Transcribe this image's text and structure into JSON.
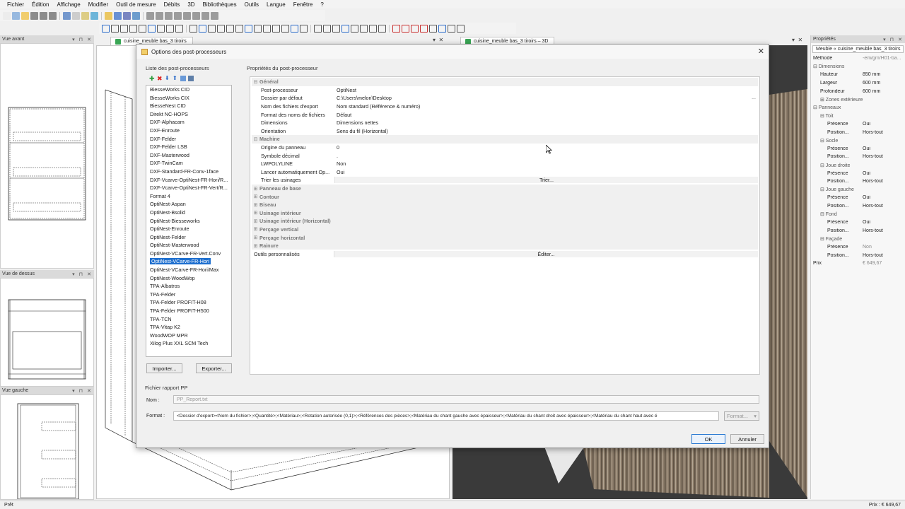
{
  "menu": [
    "Fichier",
    "Édition",
    "Affichage",
    "Modifier",
    "Outil de mesure",
    "Débits",
    "3D",
    "Bibliothèques",
    "Outils",
    "Langue",
    "Fenêtre",
    "?"
  ],
  "panes": {
    "front": "Vue avant",
    "top": "Vue de dessus",
    "left": "Vue gauche"
  },
  "tabs": {
    "doc2d": "cuisine_meuble bas_3 tiroirs",
    "doc3d": "cuisine_meuble bas_3 tiroirs – 3D"
  },
  "properties": {
    "title": "Propriétés",
    "object": "Meuble « cuisine_meuble bas_3 tiroirs",
    "rows": [
      {
        "k": "Méthode",
        "v": "-em/gm/H01-ba...",
        "indent": 0,
        "grp": false
      },
      {
        "k": "⊟ Dimensions",
        "v": "",
        "indent": 0,
        "grp": true
      },
      {
        "k": "Hauteur",
        "v": "850 mm",
        "indent": 10,
        "grp": false
      },
      {
        "k": "Largeur",
        "v": "600 mm",
        "indent": 10,
        "grp": false
      },
      {
        "k": "Profondeur",
        "v": "600 mm",
        "indent": 10,
        "grp": false
      },
      {
        "k": "⊞ Zones extérieures",
        "v": "",
        "indent": 10,
        "grp": true
      },
      {
        "k": "⊟ Panneaux",
        "v": "",
        "indent": 0,
        "grp": true
      },
      {
        "k": "⊟ Toit",
        "v": "",
        "indent": 10,
        "grp": true
      },
      {
        "k": "Présence",
        "v": "Oui",
        "indent": 20,
        "grp": false
      },
      {
        "k": "Position...",
        "v": "Hors-tout",
        "indent": 20,
        "grp": false
      },
      {
        "k": "⊟ Socle",
        "v": "",
        "indent": 10,
        "grp": true
      },
      {
        "k": "Présence",
        "v": "Oui",
        "indent": 20,
        "grp": false
      },
      {
        "k": "Position...",
        "v": "Hors-tout",
        "indent": 20,
        "grp": false
      },
      {
        "k": "⊟ Joue droite",
        "v": "",
        "indent": 10,
        "grp": true
      },
      {
        "k": "Présence",
        "v": "Oui",
        "indent": 20,
        "grp": false
      },
      {
        "k": "Position...",
        "v": "Hors-tout",
        "indent": 20,
        "grp": false
      },
      {
        "k": "⊟ Joue gauche",
        "v": "",
        "indent": 10,
        "grp": true
      },
      {
        "k": "Présence",
        "v": "Oui",
        "indent": 20,
        "grp": false
      },
      {
        "k": "Position...",
        "v": "Hors-tout",
        "indent": 20,
        "grp": false
      },
      {
        "k": "⊟ Fond",
        "v": "",
        "indent": 10,
        "grp": true
      },
      {
        "k": "Présence",
        "v": "Oui",
        "indent": 20,
        "grp": false
      },
      {
        "k": "Position...",
        "v": "Hors-tout",
        "indent": 20,
        "grp": false
      },
      {
        "k": "⊟ Façade",
        "v": "",
        "indent": 10,
        "grp": true
      },
      {
        "k": "Présence",
        "v": "Non",
        "indent": 20,
        "grp": false
      },
      {
        "k": "Position...",
        "v": "Hors-tout",
        "indent": 20,
        "grp": false
      },
      {
        "k": "Prix",
        "v": "€ 649,67",
        "indent": 0,
        "grp": false
      }
    ]
  },
  "dialog": {
    "title": "Options des post-processeurs",
    "list_label": "Liste des post-processeurs",
    "selected_index": 21,
    "items": [
      "BiesseWorks CID",
      "BiesseWorks CIX",
      "BiesseNest CID",
      "Direkt NC-HOPS",
      "DXF-Alphacam",
      "DXF-Enroute",
      "DXF-Felder",
      "DXF-Felder LSB",
      "DXF-Masterwood",
      "DXF-TwinCam",
      "DXF-Standard-FR-Conv-1face",
      "DXF-Vcarve-OptiNest-FR-Hori/R...",
      "DXF-Vcarve-OptiNest-FR-Vert/R...",
      "Format 4",
      "OptiNest-Aspan",
      "OptiNest-Bsolid",
      "OptiNest-Biesseworks",
      "OptiNest-Enroute",
      "OptiNest-Felder",
      "OptiNest-Masterwood",
      "OptiNest-VCarve-FR-Vert.Conv",
      "OptiNest-VCarve-FR-Hori",
      "OptiNest-VCarve-FR-Hori/Max",
      "OptiNest-WoodWop",
      "TPA-Albatros",
      "TPA-Felder",
      "TPA-Felder PROFIT-H08",
      "TPA-Felder PROFIT-H500",
      "TPA-TCN",
      "TPA-Vitap K2",
      "WoodWOP MPR",
      "Xilog Plus XXL SCM Tech"
    ],
    "import_label": "Importer...",
    "export_label": "Exporter...",
    "props_label": "Propriétés du post-processeur",
    "grid": [
      {
        "type": "cat",
        "name": "Général"
      },
      {
        "type": "row",
        "name": "Post-processeur",
        "value": "OptiNest"
      },
      {
        "type": "row",
        "name": "Dossier par défaut",
        "value": "C:\\Users\\melon\\Desktop",
        "dots": "..."
      },
      {
        "type": "row",
        "name": "Nom des fichiers d'export",
        "value": "Nom standard (Référence & numéro)"
      },
      {
        "type": "row",
        "name": "Format des noms de fichiers",
        "value": "Défaut"
      },
      {
        "type": "row",
        "name": "Dimensions",
        "value": "Dimensions nettes"
      },
      {
        "type": "row",
        "name": "Orientation",
        "value": "Sens du fil (Horizontal)"
      },
      {
        "type": "cat",
        "name": "Machine"
      },
      {
        "type": "row",
        "name": "Origine du panneau",
        "value": "0"
      },
      {
        "type": "row",
        "name": "Symbole décimal",
        "value": "."
      },
      {
        "type": "row",
        "name": "LWPOLYLINE",
        "value": "Non"
      },
      {
        "type": "row",
        "name": "Lancer automatiquement Op...",
        "value": "Oui"
      },
      {
        "type": "btn",
        "name": "Trier les usinages",
        "value": "Trier..."
      },
      {
        "type": "catc",
        "name": "Panneau de base"
      },
      {
        "type": "catc",
        "name": "Contour"
      },
      {
        "type": "catc",
        "name": "Biseau"
      },
      {
        "type": "catc",
        "name": "Usinage intérieur"
      },
      {
        "type": "catc",
        "name": "Usinage intérieur (Horizontal)"
      },
      {
        "type": "catc",
        "name": "Perçage vertical"
      },
      {
        "type": "catc",
        "name": "Perçage horizontal"
      },
      {
        "type": "catc",
        "name": "Rainure"
      },
      {
        "type": "plainbtn",
        "name": "Outils personnalisés",
        "value": "Éditer..."
      }
    ],
    "report_label": "Fichier rapport PP",
    "name_label": "Nom :",
    "name_value": "PP_Report.txt",
    "format_label": "Format :",
    "format_value": "<Dossier d'export><Nom du fichier>;<Quantité>;<Matériau>;<Rotation autorisée (0,1)>;<Références des pièces>;<Matériau du chant gauche avec épaisseur>;<Matériau du chant droit avec épaisseur>;<Matériau du chant haut avec é",
    "format_btn": "Format...",
    "ok_label": "OK",
    "cancel_label": "Annuler"
  },
  "status": {
    "left": "Prêt",
    "right": "Prix : € 649,67"
  },
  "colors": {
    "selection": "#1e6fcf",
    "wood": "#8a7a68"
  }
}
